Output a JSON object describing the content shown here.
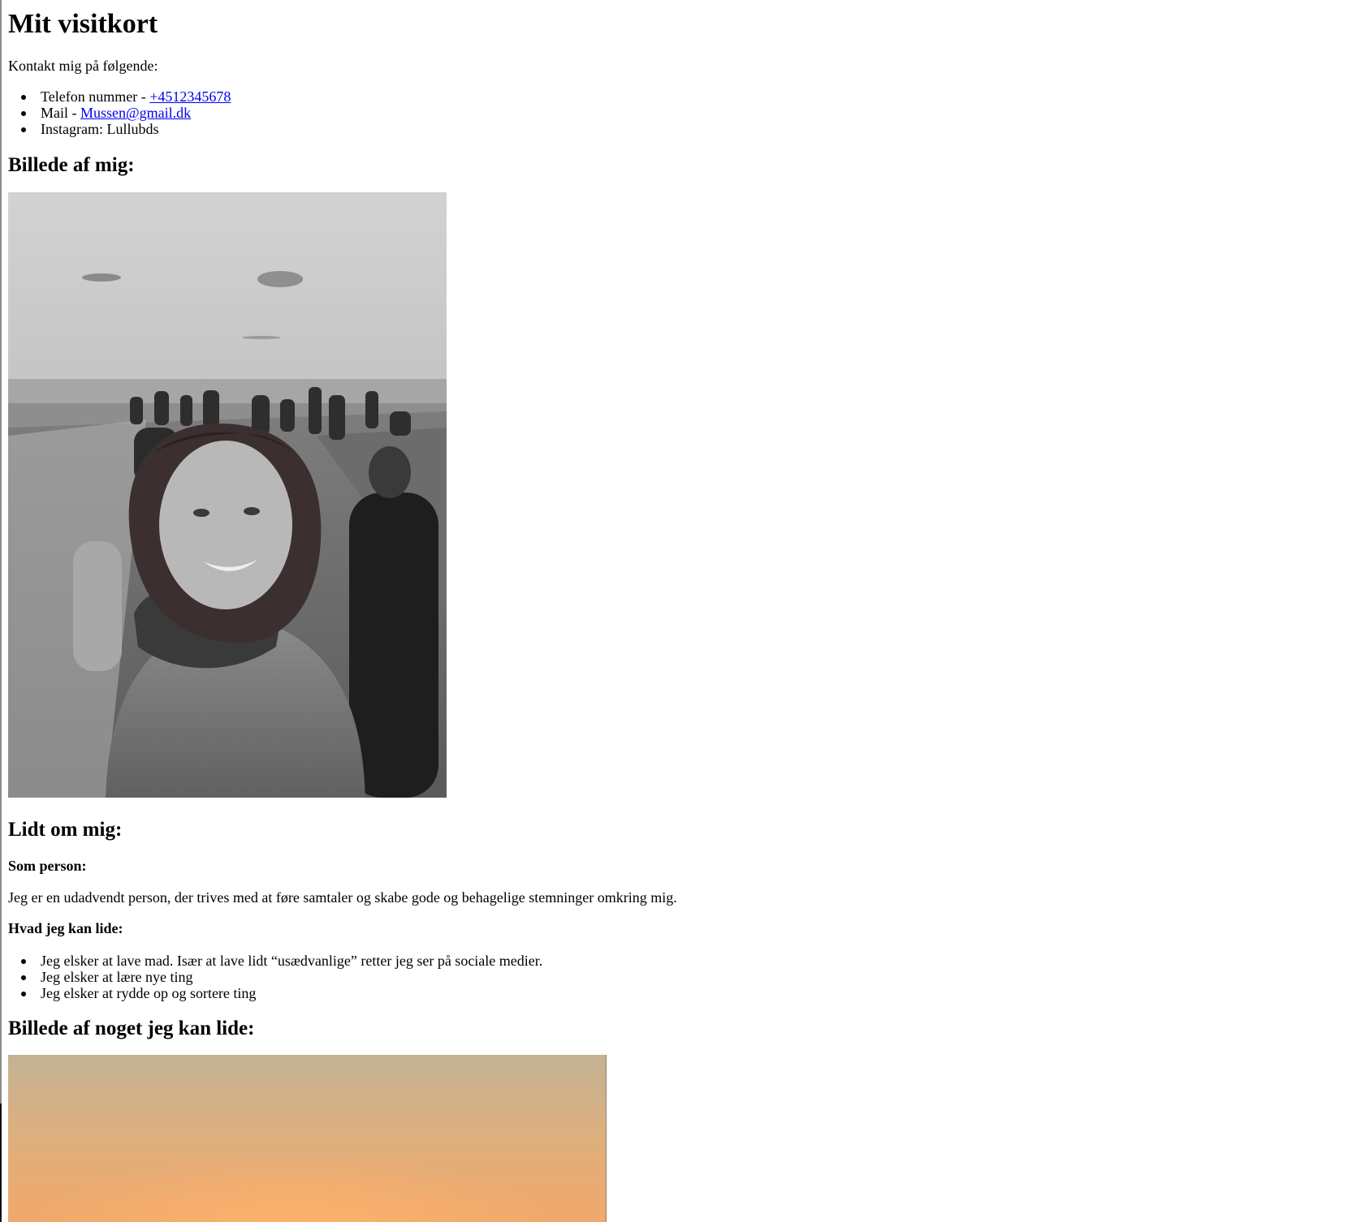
{
  "page": {
    "title": "Mit visitkort",
    "contact_intro": "Kontakt mig på følgende:"
  },
  "contact": {
    "phone_label": "Telefon nummer - ",
    "phone_value": "+4512345678",
    "mail_label": "Mail - ",
    "mail_value": "Mussen@gmail.dk",
    "instagram_text": "Instagram: Lullubds"
  },
  "photo_me": {
    "heading": "Billede af mig:"
  },
  "about": {
    "heading": "Lidt om mig:",
    "person_heading": "Som person:",
    "person_text": "Jeg er en udadvendt person, der trives med at føre samtaler og skabe gode og behagelige stemninger omkring mig.",
    "likes_heading": "Hvad jeg kan lide:",
    "likes": [
      "Jeg elsker at lave mad. Især at lave lidt “usædvanlige” retter jeg ser på sociale medier.",
      "Jeg elsker at lære nye ting",
      "Jeg elsker at rydde op og sortere ting"
    ]
  },
  "photo_likes": {
    "heading": "Billede af noget jeg kan lide:"
  },
  "colors": {
    "link": "#0000ee",
    "text": "#000000",
    "background": "#ffffff"
  }
}
